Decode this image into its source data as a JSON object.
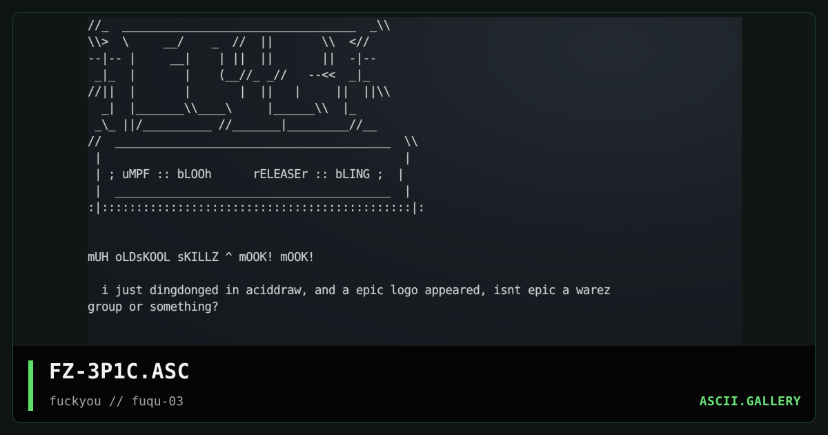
{
  "art": {
    "lines": [
      "//_  __________________________________  _\\\\",
      "\\\\>  \\     __/    _  //  ||       \\\\  <//",
      "--|-- |     __|    | ||  ||       ||  -|--",
      " _|_  |       |    (__//_ _//   --<<  _|_",
      "//||  |       |       |  ||   |     ||  ||\\\\",
      "  _|  |_______\\\\____\\     |______\\\\  |_",
      " _\\_ ||/__________ //_______|_________//__",
      "//  ________________________________________  \\\\",
      " |                                            |",
      " | ; uMPF :: bLOOh      rELEASEr :: bLING ;  |",
      " |  ________________________________________  |",
      ":|:::::::::::::::::::::::::::::::::::::::::::::|:",
      "",
      "",
      "mUH oLDsKOOL sKILLZ ^ mOOK! mOOK!",
      "",
      "  i just dingdonged in aciddraw, and a epic logo appeared, isnt epic a warez",
      "group or something?"
    ]
  },
  "footer": {
    "title": "FZ-3P1C.ASC",
    "subtitle": "fuckyou // fuqu-03",
    "brand": "ASCII.GALLERY"
  },
  "colors": {
    "accent": "#5de06a",
    "brand": "#6ee27a",
    "frame_border": "#1d4a24"
  }
}
